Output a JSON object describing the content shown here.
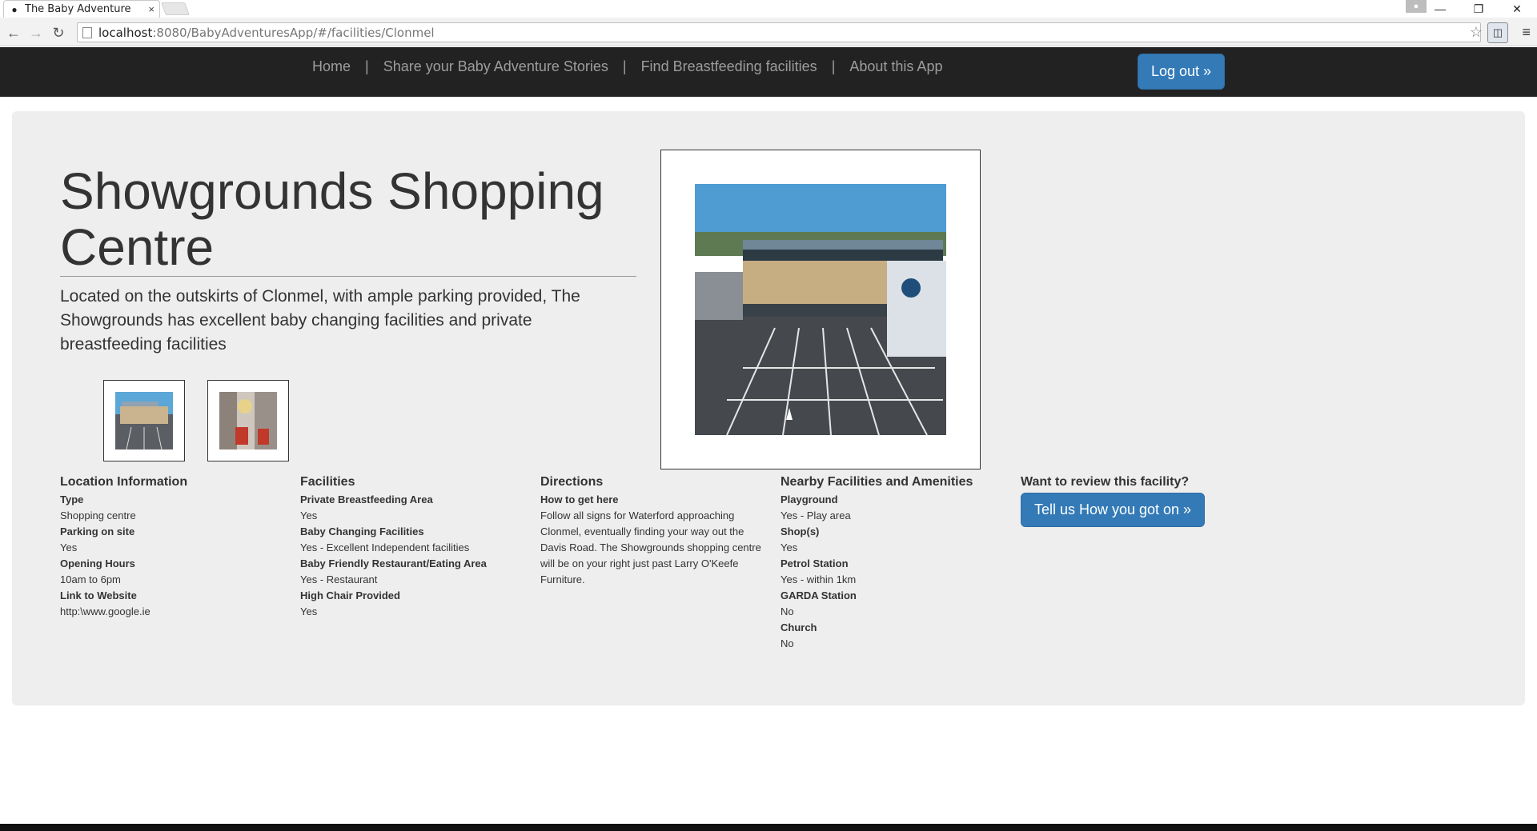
{
  "browser": {
    "tab_title": "The Baby Adventure",
    "tab_close": "×",
    "url_host": "localhost",
    "url_path": ":8080/BabyAdventuresApp/#/facilities/Clonmel",
    "back_icon": "←",
    "forward_icon": "→",
    "reload_icon": "C",
    "star_icon": "☆",
    "menu_icon": "≡",
    "minimize_icon": "—",
    "restore_icon": "❐",
    "close_icon": "✕"
  },
  "navbar": {
    "links": [
      "Home",
      "Share your Baby Adventure Stories",
      "Find Breastfeeding facilities",
      "About this App"
    ],
    "separator": "|",
    "logout_label": "Log out »"
  },
  "facility": {
    "title": "Showgrounds Shopping Centre",
    "description": "Located on the outskirts of Clonmel, with ample parking provided, The Showgrounds has excellent baby changing facilities and private breastfeeding facilities"
  },
  "location": {
    "heading": "Location Information",
    "items": [
      {
        "label": "Type",
        "value": "Shopping centre"
      },
      {
        "label": "Parking on site",
        "value": "Yes"
      },
      {
        "label": "Opening Hours",
        "value": "10am to 6pm"
      },
      {
        "label": "Link to Website",
        "value": "http:\\www.google.ie"
      }
    ]
  },
  "facilities": {
    "heading": "Facilities",
    "items": [
      {
        "label": "Private Breastfeeding Area",
        "value": "Yes"
      },
      {
        "label": "Baby Changing Facilities",
        "value": "Yes - Excellent Independent facilities"
      },
      {
        "label": "Baby Friendly Restaurant/Eating Area",
        "value": "Yes - Restaurant"
      },
      {
        "label": "High Chair Provided",
        "value": "Yes"
      }
    ]
  },
  "directions": {
    "heading": "Directions",
    "label": "How to get here",
    "text": "Follow all signs for Waterford approaching Clonmel, eventually finding your way out the Davis Road. The Showgrounds shopping centre will be on your right just past Larry O'Keefe Furniture."
  },
  "nearby": {
    "heading": "Nearby Facilities and Amenities",
    "items": [
      {
        "label": "Playground",
        "value": "Yes - Play area"
      },
      {
        "label": "Shop(s)",
        "value": "Yes"
      },
      {
        "label": "Petrol Station",
        "value": "Yes - within 1km"
      },
      {
        "label": "GARDA Station",
        "value": "No"
      },
      {
        "label": "Church",
        "value": "No"
      }
    ]
  },
  "review": {
    "heading": "Want to review this facility?",
    "button_label": "Tell us How you got on »"
  }
}
